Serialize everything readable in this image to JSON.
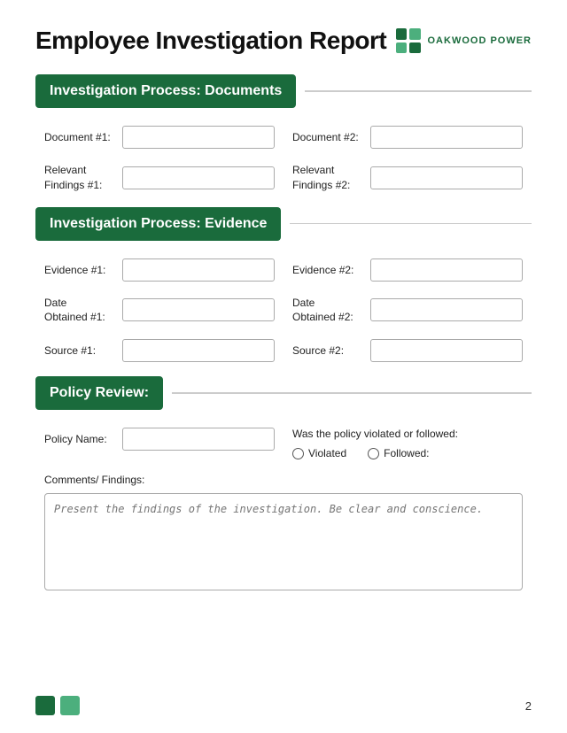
{
  "header": {
    "title": "Employee Investigation Report",
    "logo_text": "OAKWOOD POWER"
  },
  "sections": {
    "documents": {
      "label": "Investigation Process: Documents",
      "fields": [
        {
          "id": "doc1",
          "label": "Document #1:"
        },
        {
          "id": "doc2",
          "label": "Document #2:"
        },
        {
          "id": "findings1",
          "label": "Relevant\nFindings #1:"
        },
        {
          "id": "findings2",
          "label": "Relevant\nFindings #2:"
        }
      ]
    },
    "evidence": {
      "label": "Investigation Process: Evidence",
      "fields": [
        {
          "id": "ev1",
          "label": "Evidence #1:"
        },
        {
          "id": "ev2",
          "label": "Evidence #2:"
        },
        {
          "id": "date1",
          "label": "Date\nObtained #1:"
        },
        {
          "id": "date2",
          "label": "Date\nObtained #2:"
        },
        {
          "id": "source1",
          "label": "Source #1:"
        },
        {
          "id": "source2",
          "label": "Source #2:"
        }
      ]
    },
    "policy": {
      "label": "Policy Review:",
      "policy_name_label": "Policy Name:",
      "policy_question": "Was the policy violated or followed:",
      "radio_options": [
        {
          "id": "violated",
          "label": "Violated"
        },
        {
          "id": "followed",
          "label": "Followed:"
        }
      ],
      "comments_label": "Comments/ Findings:",
      "comments_placeholder": "Present the findings of the investigation. Be clear and conscience."
    }
  },
  "footer": {
    "page_number": "2"
  },
  "colors": {
    "green_dark": "#1a6b3c",
    "green_light": "#4caf7d"
  }
}
